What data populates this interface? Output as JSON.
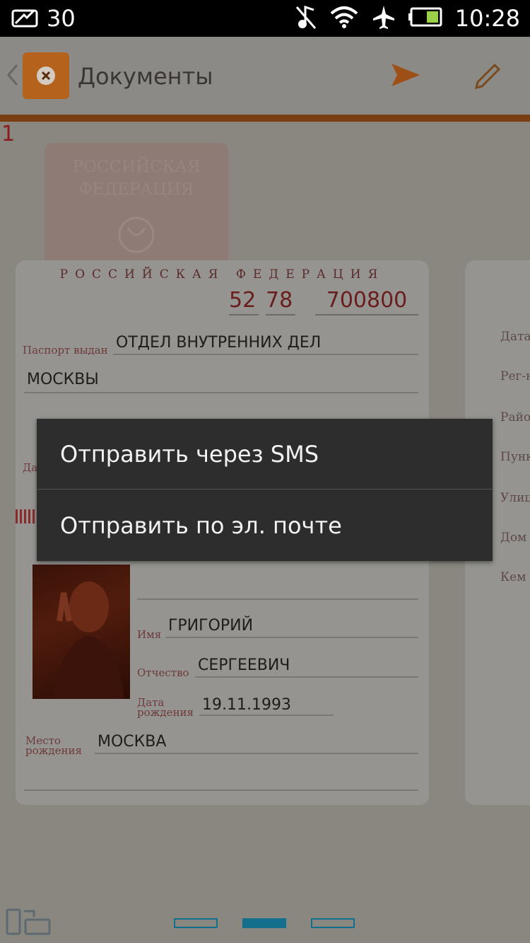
{
  "status_bar": {
    "notification_count": "30",
    "time": "10:28",
    "icons": [
      "mail-icon",
      "no-music-icon",
      "wifi-icon",
      "airplane-icon",
      "battery-icon"
    ]
  },
  "app_bar": {
    "title": "Документы",
    "icons": [
      "back-chevron-icon",
      "app-logo-icon",
      "send-icon",
      "edit-icon"
    ]
  },
  "page_indicator_text": "1",
  "cover": {
    "line1": "РОССИЙСКАЯ",
    "line2": "ФЕДЕРАЦИЯ"
  },
  "passport": {
    "header": "РОССИЙСКАЯ ФЕДЕРАЦИЯ",
    "series_1": "52",
    "series_2": "78",
    "number": "700800",
    "issued_by_label": "Паспорт выдан",
    "issued_by_value": "ОТДЕЛ ВНУТРЕННИХ ДЕЛ",
    "issued_by_value_2": "МОСКВЫ",
    "date_label_partial": "Да",
    "first_name_label": "Имя",
    "first_name": "ГРИГОРИЙ",
    "patronymic_label": "Отчество",
    "patronymic": "СЕРГЕЕВИЧ",
    "birth_date_label_1": "Дата",
    "birth_date_label_2": "рождения",
    "birth_date": "19.11.1993",
    "birth_place_label_1": "Место",
    "birth_place_label_2": "рождения",
    "birth_place": "МОСКВА"
  },
  "right_page": {
    "labels": [
      "Дата",
      "Рег-н",
      "Райо",
      "Пунк",
      "Улиц",
      "Дом",
      "Кем"
    ]
  },
  "popup_menu": {
    "items": [
      "Отправить через SMS",
      "Отправить по эл. почте"
    ]
  },
  "page_dots": {
    "count": 3,
    "active_index": 1
  },
  "colors": {
    "accent": "#f26b1d",
    "dot_active": "#136f8c",
    "popup_bg": "#2d2d2d"
  }
}
